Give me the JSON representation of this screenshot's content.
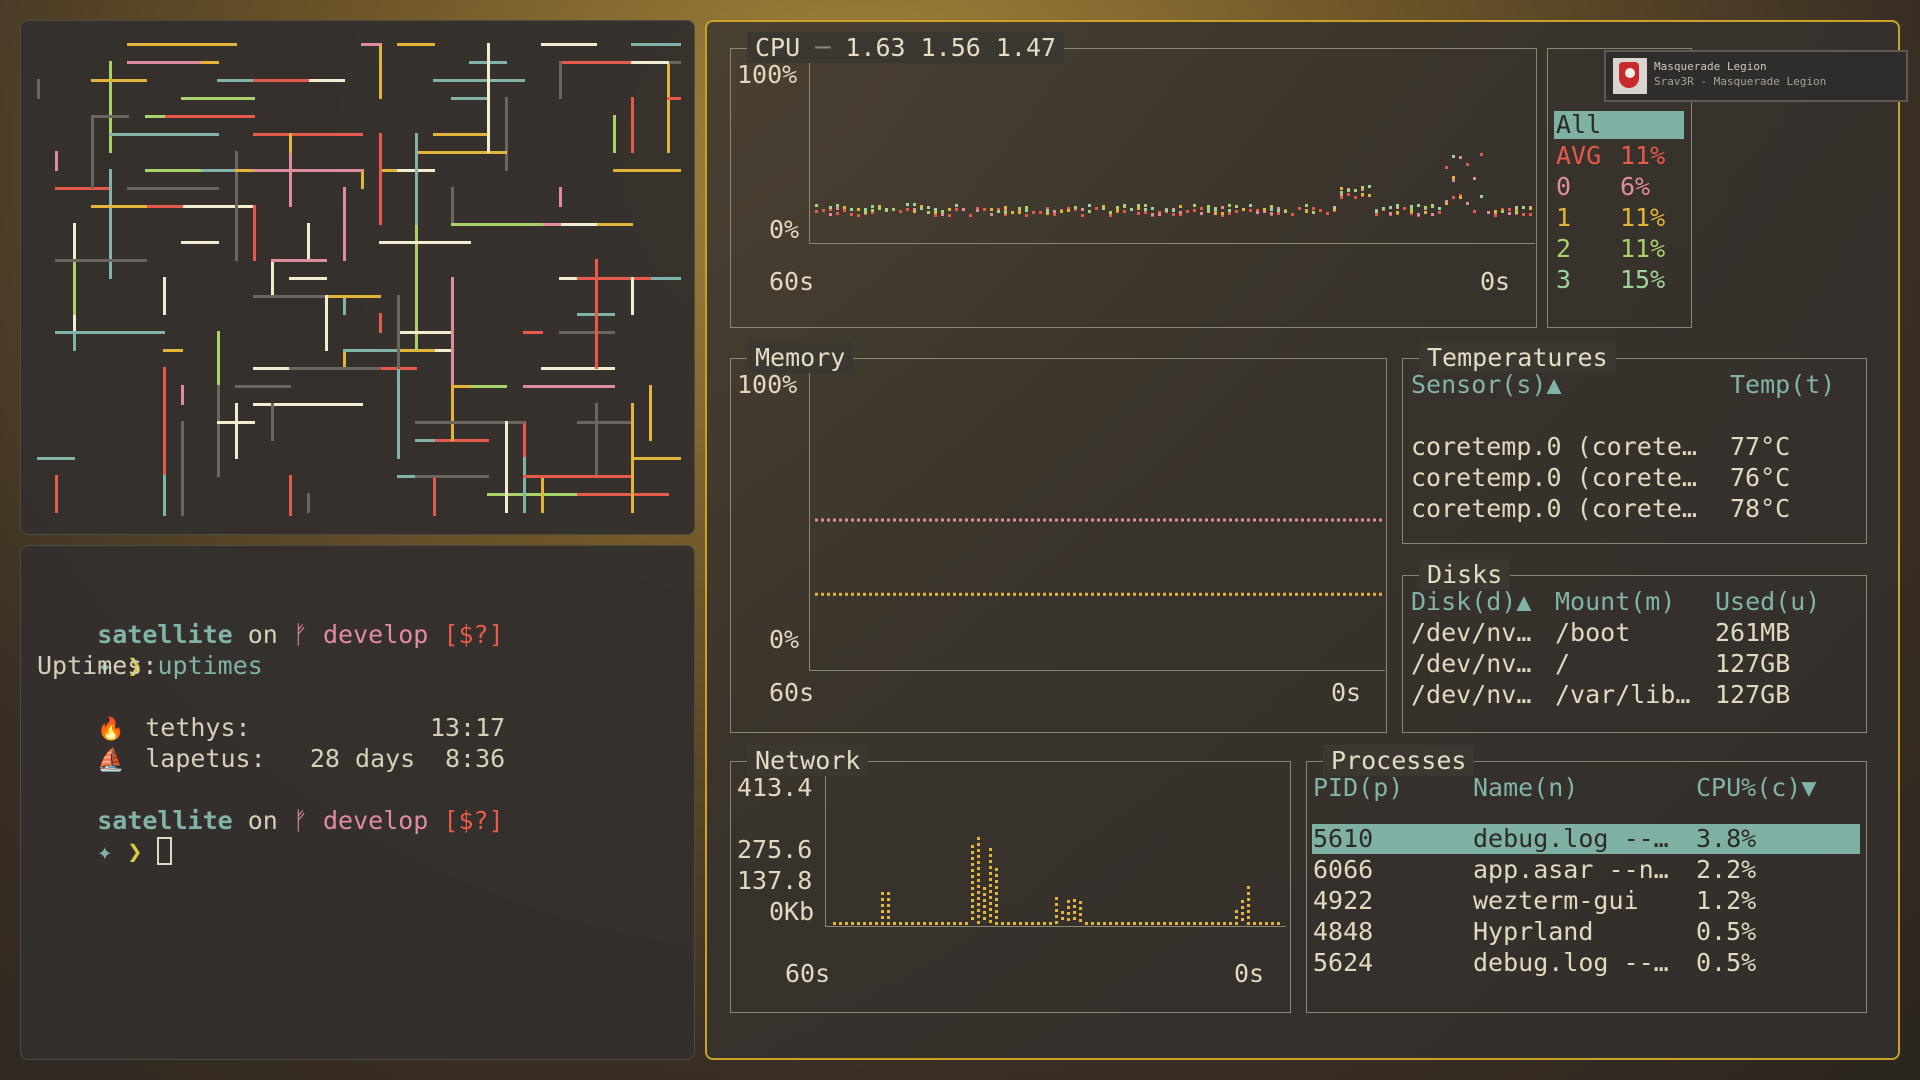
{
  "terminal": {
    "prompt1": {
      "dir": "satellite",
      "on": "on",
      "branch_icon": "ᚠ",
      "branch": "develop",
      "status": "[$?]"
    },
    "command": {
      "symbol": "✦",
      "arrow": "❯",
      "text": "uptimes"
    },
    "output_header": "Uptimes:",
    "hosts": [
      {
        "icon": "🔥",
        "name": "tethys:",
        "days": "",
        "time": "13:17"
      },
      {
        "icon": "⛵",
        "name": "lapetus:",
        "days": "28 days",
        "time": "8:36"
      }
    ],
    "prompt2": {
      "dir": "satellite",
      "on": "on",
      "branch_icon": "ᚠ",
      "branch": "develop",
      "status": "[$?]"
    },
    "prompt2_symbol": "✦",
    "prompt2_arrow": "❯"
  },
  "cpu": {
    "title": "CPU",
    "sep": "─",
    "load": "1.63 1.56 1.47",
    "y_top": "100%",
    "y_bottom": "0%",
    "x_left": "60s",
    "x_right": "0s",
    "legend": [
      {
        "label": "All",
        "value": "",
        "color": "#dcd3bb"
      },
      {
        "label": "AVG",
        "value": "11%",
        "color": "#e65a4b"
      },
      {
        "label": "0",
        "value": "6%",
        "color": "#e08c9f"
      },
      {
        "label": "1",
        "value": "11%",
        "color": "#e2b53a"
      },
      {
        "label": "2",
        "value": "11%",
        "color": "#a9d36a"
      },
      {
        "label": "3",
        "value": "15%",
        "color": "#9fd39a"
      }
    ]
  },
  "notification": {
    "title": "Masquerade Legion",
    "subtitle": "Srav3R - Masquerade Legion"
  },
  "memory": {
    "title": "Memory",
    "y_top": "100%",
    "y_bottom": "0%",
    "x_left": "60s",
    "x_right": "0s",
    "ram_percent": 51,
    "swap_percent": 26
  },
  "temperatures": {
    "title": "Temperatures",
    "col_sensor": "Sensor(s)▲",
    "col_temp": "Temp(t)",
    "rows": [
      {
        "sensor": "coretemp.0 (corete…",
        "temp": "77°C"
      },
      {
        "sensor": "coretemp.0 (corete…",
        "temp": "76°C"
      },
      {
        "sensor": "coretemp.0 (corete…",
        "temp": "78°C"
      }
    ]
  },
  "disks": {
    "title": "Disks",
    "col_disk": "Disk(d)▲",
    "col_mount": "Mount(m)",
    "col_used": "Used(u)",
    "rows": [
      {
        "disk": "/dev/nv…",
        "mount": "/boot",
        "used": "261MB"
      },
      {
        "disk": "/dev/nv…",
        "mount": "/",
        "used": "127GB"
      },
      {
        "disk": "/dev/nv…",
        "mount": "/var/lib…",
        "used": "127GB"
      }
    ]
  },
  "network": {
    "title": "Network",
    "y_labels": [
      "413.4",
      "275.6",
      "137.8",
      "0Kb"
    ],
    "x_left": "60s",
    "x_right": "0s"
  },
  "processes": {
    "title": "Processes",
    "col_pid": "PID(p)",
    "col_name": "Name(n)",
    "col_cpu": "CPU%(c)▼",
    "rows": [
      {
        "pid": "5610",
        "name": "debug.log --…",
        "cpu": "3.8%"
      },
      {
        "pid": "6066",
        "name": "app.asar --n…",
        "cpu": "2.2%"
      },
      {
        "pid": "4922",
        "name": "wezterm-gui",
        "cpu": "1.2%"
      },
      {
        "pid": "4848",
        "name": "Hyprland",
        "cpu": "0.5%"
      },
      {
        "pid": "5624",
        "name": "debug.log --…",
        "cpu": "0.5%"
      }
    ]
  },
  "colors": {
    "accent_border": "#c9a227",
    "prompt_dir": "#82b3a8",
    "prompt_branch": "#e08c9f",
    "prompt_status": "#e65a4b",
    "prompt_arrow": "#d7cf3a",
    "selected_row_bg": "#7fb0a4"
  }
}
